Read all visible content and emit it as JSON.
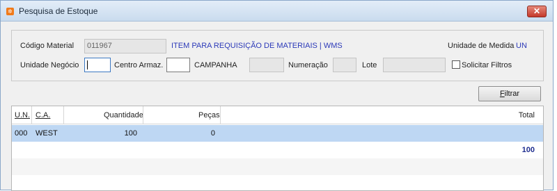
{
  "window": {
    "title": "Pesquisa de Estoque",
    "close_label": "✕"
  },
  "form": {
    "codigo_material_label": "Código Material",
    "codigo_material_value": "011967",
    "material_desc": "ITEM PARA REQUISIÇÃO DE MATERIAIS | WMS",
    "unidade_medida_label": "Unidade de Medida",
    "unidade_medida_value": "UN",
    "unidade_negocio_label": "Unidade Negócio",
    "unidade_negocio_value": "",
    "centro_armaz_label": "Centro Armaz.",
    "centro_armaz_value": "",
    "campanha_label": "CAMPANHA",
    "campanha_value": "",
    "numeracao_label": "Numeração",
    "numeracao_value": "",
    "lote_label": "Lote",
    "lote_value": "",
    "solicitar_filtros_label": "Solicitar Filtros",
    "solicitar_filtros_checked": false
  },
  "filter_button": {
    "label_prefix": "F",
    "label_rest": "iltrar"
  },
  "grid": {
    "columns": [
      {
        "label": "U.N."
      },
      {
        "label": "C.A."
      },
      {
        "label": "Quantidade"
      },
      {
        "label": "Peças"
      },
      {
        "label": "Total"
      }
    ],
    "rows": [
      {
        "un": "000",
        "ca": "WEST",
        "quantidade": "100",
        "pecas": "0",
        "total": ""
      }
    ],
    "total_sum": "100"
  },
  "colors": {
    "selected_row": "#bed7f3",
    "link_blue": "#2b39b8",
    "sum_blue": "#1e2d8f"
  }
}
